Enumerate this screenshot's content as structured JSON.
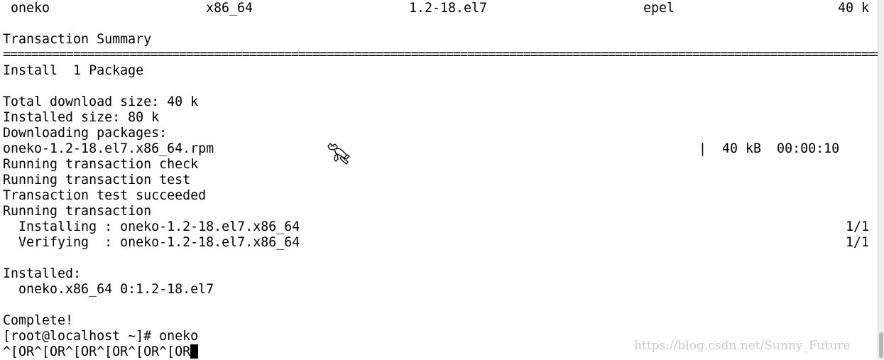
{
  "terminal": {
    "pkg_row": {
      "name": "oneko",
      "arch": "x86_64",
      "version": "1.2-18.el7",
      "repo": "epel",
      "size": "40 k"
    },
    "transaction_summary": "Transaction Summary",
    "separator": "================================================================================================================================",
    "install_line": "Install  1 Package",
    "total_download": "Total download size: 40 k",
    "installed_size": "Installed size: 80 k",
    "downloading": "Downloading packages:",
    "rpm_file": "oneko-1.2-18.el7.x86_64.rpm",
    "rpm_progress": "|  40 kB  00:00:10",
    "check": "Running transaction check",
    "test": "Running transaction test",
    "test_ok": "Transaction test succeeded",
    "running": "Running transaction",
    "installing": "  Installing : oneko-1.2-18.el7.x86_64",
    "installing_count": "1/1",
    "verifying": "  Verifying  : oneko-1.2-18.el7.x86_64",
    "verifying_count": "1/1",
    "installed_hdr": "Installed:",
    "installed_pkg": "  oneko.x86_64 0:1.2-18.el7",
    "complete": "Complete!",
    "prompt": "[root@localhost ~]# oneko",
    "input_line": "^[OR^[OR^[OR^[OR^[OR^[OR"
  },
  "watermark": "https://blog.csdn.net/Sunny_Future",
  "colors": {
    "background": "#ffffff",
    "text": "#000000",
    "watermark": "#c9c9c9"
  },
  "icons": {
    "oneko_cat": "oneko-cat-icon"
  }
}
